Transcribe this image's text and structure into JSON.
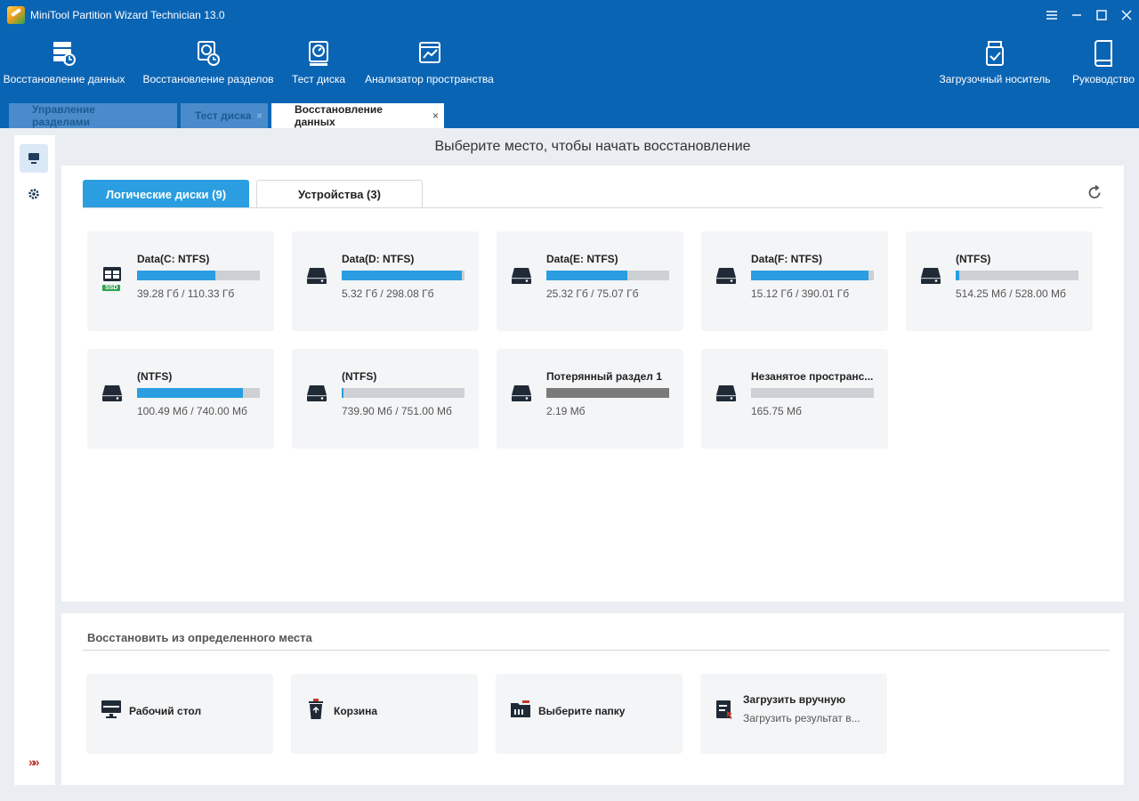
{
  "app": {
    "title": "MiniTool Partition Wizard Technician 13.0"
  },
  "toolbar": {
    "items": [
      {
        "label": "Восстановление данных",
        "icon": "data-recovery-icon"
      },
      {
        "label": "Восстановление разделов",
        "icon": "partition-recovery-icon"
      },
      {
        "label": "Тест диска",
        "icon": "disk-benchmark-icon"
      },
      {
        "label": "Анализатор пространства",
        "icon": "space-analyzer-icon"
      },
      {
        "label": "Загрузочный носитель",
        "icon": "bootable-media-icon"
      },
      {
        "label": "Руководство",
        "icon": "manual-icon"
      }
    ]
  },
  "tabs": [
    {
      "label": "Управление разделами",
      "closable": false,
      "active": false
    },
    {
      "label": "Тест диска",
      "closable": true,
      "active": false
    },
    {
      "label": "Восстановление данных",
      "closable": true,
      "active": true
    }
  ],
  "heading": "Выберите место, чтобы начать восстановление",
  "drive_tabs": {
    "logical": "Логические диски (9)",
    "devices": "Устройства (3)"
  },
  "drives": [
    {
      "name": "Data(C: NTFS)",
      "size": "39.28 Гб / 110.33 Гб",
      "used": 0.64,
      "ssd": true
    },
    {
      "name": "Data(D: NTFS)",
      "size": "5.32 Гб / 298.08 Гб",
      "used": 0.98
    },
    {
      "name": "Data(E: NTFS)",
      "size": "25.32 Гб / 75.07 Гб",
      "used": 0.66
    },
    {
      "name": "Data(F: NTFS)",
      "size": "15.12 Гб / 390.01 Гб",
      "used": 0.96
    },
    {
      "name": "(NTFS)",
      "size": "514.25 Мб / 528.00 Мб",
      "used": 0.03
    },
    {
      "name": "(NTFS)",
      "size": "100.49 Мб / 740.00 Мб",
      "used": 0.86
    },
    {
      "name": "(NTFS)",
      "size": "739.90 Мб / 751.00 Мб",
      "used": 0.015
    },
    {
      "name": "Потерянный раздел 1",
      "size": "2.19 Мб",
      "used": 1.0,
      "grey": true
    },
    {
      "name": "Незанятое пространс...",
      "size": "165.75 Мб",
      "used": 0
    }
  ],
  "ssd_badge": "SSD",
  "recover_from": {
    "title": "Восстановить из определенного места",
    "items": [
      {
        "label": "Рабочий стол",
        "icon": "desktop-icon"
      },
      {
        "label": "Корзина",
        "icon": "recycle-bin-icon"
      },
      {
        "label": "Выберите папку",
        "icon": "folder-icon"
      },
      {
        "label": "Загрузить вручную",
        "sub": "Загрузить результат в...",
        "icon": "load-manually-icon"
      }
    ]
  },
  "colors": {
    "brand": "#0a64b4",
    "accent": "#2a9ee0",
    "lost_partition": "#7a7a7a"
  }
}
